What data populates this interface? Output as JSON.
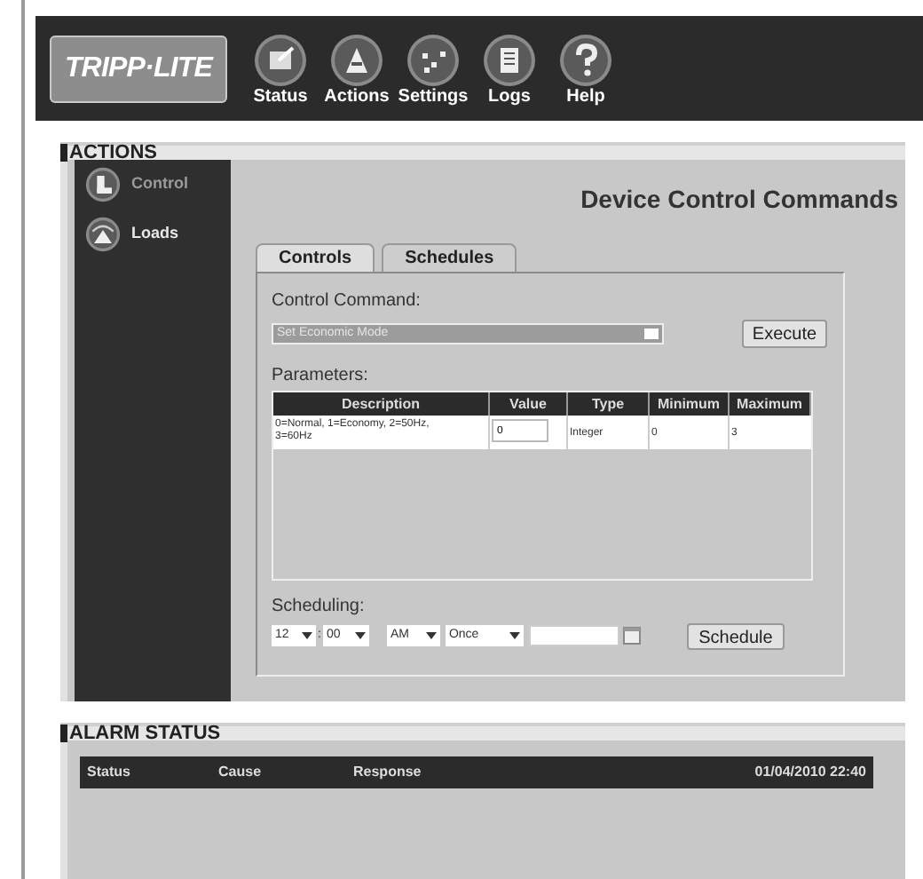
{
  "header": {
    "logo": "TRIPP·LITE",
    "nav": [
      {
        "label": "Status"
      },
      {
        "label": "Actions"
      },
      {
        "label": "Settings"
      },
      {
        "label": "Logs"
      },
      {
        "label": "Help"
      }
    ]
  },
  "actions": {
    "title": "ACTIONS",
    "sidebar": [
      {
        "label": "Control",
        "selected": true
      },
      {
        "label": "Loads",
        "selected": false
      }
    ],
    "heading": "Device Control Commands",
    "tabs": [
      {
        "label": "Controls",
        "selected": true
      },
      {
        "label": "Schedules",
        "selected": false
      }
    ],
    "command_label": "Control Command:",
    "command_value": "Set Economic Mode",
    "execute": "Execute",
    "parameters_label": "Parameters:",
    "columns": [
      "Description",
      "Value",
      "Type",
      "Minimum",
      "Maximum"
    ],
    "rows": [
      {
        "description": "0=Normal, 1=Economy, 2=50Hz, 3=60Hz",
        "value": "0",
        "type": "Integer",
        "minimum": "0",
        "maximum": "3"
      }
    ],
    "scheduling_label": "Scheduling:",
    "hour": "12",
    "separator": ":",
    "minute": "00",
    "ampm": "AM",
    "repeat": "Once",
    "schedule": "Schedule"
  },
  "alarm": {
    "title": "ALARM STATUS",
    "columns": [
      "Status",
      "Cause",
      "Response"
    ],
    "timestamp": "01/04/2010 22:40"
  }
}
